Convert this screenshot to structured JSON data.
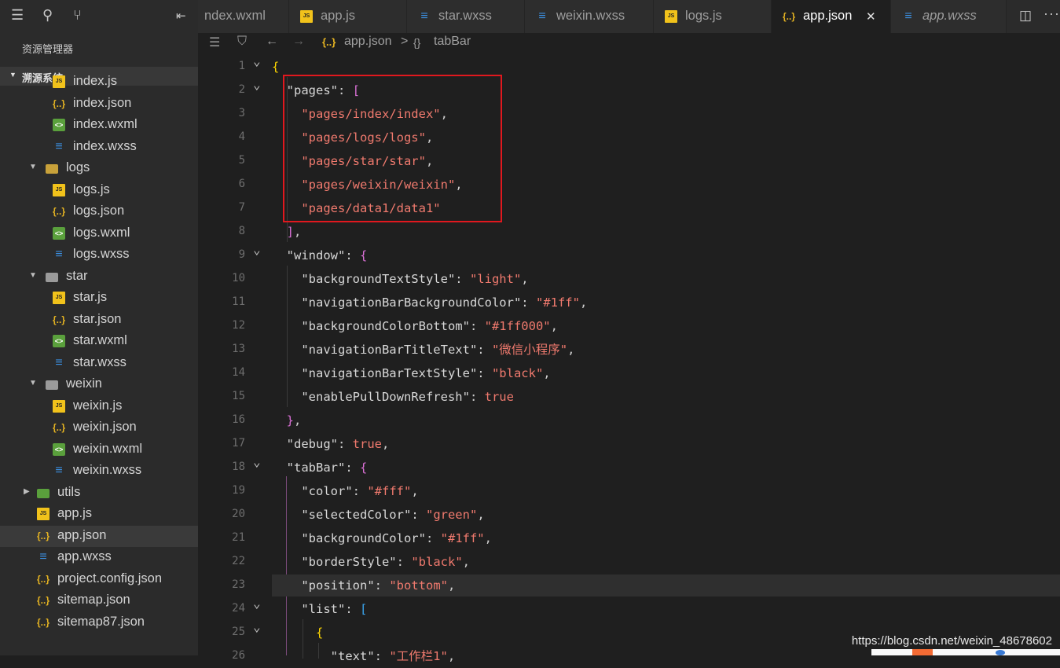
{
  "sidebar": {
    "title": "资源管理器",
    "section": "溯源系统",
    "items": [
      {
        "name": "index.js",
        "type": "js",
        "indent": 2,
        "twisty": ""
      },
      {
        "name": "index.json",
        "type": "json",
        "indent": 2,
        "twisty": ""
      },
      {
        "name": "index.wxml",
        "type": "wxml",
        "indent": 2,
        "twisty": ""
      },
      {
        "name": "index.wxss",
        "type": "wxss",
        "indent": 2,
        "twisty": ""
      },
      {
        "name": "logs",
        "type": "folder-open",
        "indent": 1,
        "twisty": "▼"
      },
      {
        "name": "logs.js",
        "type": "js",
        "indent": 2,
        "twisty": ""
      },
      {
        "name": "logs.json",
        "type": "json",
        "indent": 2,
        "twisty": ""
      },
      {
        "name": "logs.wxml",
        "type": "wxml",
        "indent": 2,
        "twisty": ""
      },
      {
        "name": "logs.wxss",
        "type": "wxss",
        "indent": 2,
        "twisty": ""
      },
      {
        "name": "star",
        "type": "folder",
        "indent": 1,
        "twisty": "▼"
      },
      {
        "name": "star.js",
        "type": "js",
        "indent": 2,
        "twisty": ""
      },
      {
        "name": "star.json",
        "type": "json",
        "indent": 2,
        "twisty": ""
      },
      {
        "name": "star.wxml",
        "type": "wxml",
        "indent": 2,
        "twisty": ""
      },
      {
        "name": "star.wxss",
        "type": "wxss",
        "indent": 2,
        "twisty": ""
      },
      {
        "name": "weixin",
        "type": "folder",
        "indent": 1,
        "twisty": "▼"
      },
      {
        "name": "weixin.js",
        "type": "js",
        "indent": 2,
        "twisty": ""
      },
      {
        "name": "weixin.json",
        "type": "json",
        "indent": 2,
        "twisty": ""
      },
      {
        "name": "weixin.wxml",
        "type": "wxml",
        "indent": 2,
        "twisty": ""
      },
      {
        "name": "weixin.wxss",
        "type": "wxss",
        "indent": 2,
        "twisty": ""
      },
      {
        "name": "utils",
        "type": "utils",
        "indent": 0,
        "twisty": "▶"
      },
      {
        "name": "app.js",
        "type": "js",
        "indent": 0,
        "twisty": ""
      },
      {
        "name": "app.json",
        "type": "json",
        "indent": 0,
        "twisty": "",
        "selected": true
      },
      {
        "name": "app.wxss",
        "type": "wxss",
        "indent": 0,
        "twisty": ""
      },
      {
        "name": "project.config.json",
        "type": "json",
        "indent": 0,
        "twisty": ""
      },
      {
        "name": "sitemap.json",
        "type": "json",
        "indent": 0,
        "twisty": ""
      },
      {
        "name": "sitemap87.json",
        "type": "json",
        "indent": 0,
        "twisty": ""
      }
    ]
  },
  "icons": {
    "js": "JS",
    "json": "{..}",
    "wxml": "<>",
    "wxss": "≡"
  },
  "tabs": [
    {
      "label": "ndex.wxml",
      "type": "",
      "active": false
    },
    {
      "label": "app.js",
      "type": "js",
      "active": false
    },
    {
      "label": "star.wxss",
      "type": "wxss",
      "active": false
    },
    {
      "label": "weixin.wxss",
      "type": "wxss",
      "active": false
    },
    {
      "label": "logs.js",
      "type": "js",
      "active": false
    },
    {
      "label": "app.json",
      "type": "json",
      "active": true
    },
    {
      "label": "app.wxss",
      "type": "wxss",
      "active": false,
      "italic": true
    }
  ],
  "breadcrumb": {
    "file": "app.json",
    "separator": ">",
    "symbol": "tabBar"
  },
  "code": [
    {
      "n": 1,
      "fold": true,
      "toks": [
        [
          "b1",
          "{"
        ]
      ]
    },
    {
      "n": 2,
      "fold": true,
      "toks": [
        [
          "sp",
          "  "
        ],
        [
          "key",
          "\"pages\""
        ],
        [
          "p",
          ": "
        ],
        [
          "b2",
          "["
        ]
      ]
    },
    {
      "n": 3,
      "toks": [
        [
          "sp",
          "    "
        ],
        [
          "str",
          "\"pages/index/index\""
        ],
        [
          "p",
          ","
        ]
      ]
    },
    {
      "n": 4,
      "toks": [
        [
          "sp",
          "    "
        ],
        [
          "str",
          "\"pages/logs/logs\""
        ],
        [
          "p",
          ","
        ]
      ]
    },
    {
      "n": 5,
      "toks": [
        [
          "sp",
          "    "
        ],
        [
          "str",
          "\"pages/star/star\""
        ],
        [
          "p",
          ","
        ]
      ]
    },
    {
      "n": 6,
      "toks": [
        [
          "sp",
          "    "
        ],
        [
          "str",
          "\"pages/weixin/weixin\""
        ],
        [
          "p",
          ","
        ]
      ]
    },
    {
      "n": 7,
      "toks": [
        [
          "sp",
          "    "
        ],
        [
          "str",
          "\"pages/data1/data1\""
        ]
      ]
    },
    {
      "n": 8,
      "toks": [
        [
          "sp",
          "  "
        ],
        [
          "b2",
          "]"
        ],
        [
          "p",
          ","
        ]
      ]
    },
    {
      "n": 9,
      "fold": true,
      "toks": [
        [
          "sp",
          "  "
        ],
        [
          "key",
          "\"window\""
        ],
        [
          "p",
          ": "
        ],
        [
          "b2",
          "{"
        ]
      ]
    },
    {
      "n": 10,
      "toks": [
        [
          "sp",
          "    "
        ],
        [
          "key",
          "\"backgroundTextStyle\""
        ],
        [
          "p",
          ": "
        ],
        [
          "str",
          "\"light\""
        ],
        [
          "p",
          ","
        ]
      ]
    },
    {
      "n": 11,
      "toks": [
        [
          "sp",
          "    "
        ],
        [
          "key",
          "\"navigationBarBackgroundColor\""
        ],
        [
          "p",
          ": "
        ],
        [
          "str",
          "\"#1ff\""
        ],
        [
          "p",
          ","
        ]
      ]
    },
    {
      "n": 12,
      "toks": [
        [
          "sp",
          "    "
        ],
        [
          "key",
          "\"backgroundColorBottom\""
        ],
        [
          "p",
          ": "
        ],
        [
          "str",
          "\"#1ff000\""
        ],
        [
          "p",
          ","
        ]
      ]
    },
    {
      "n": 13,
      "toks": [
        [
          "sp",
          "    "
        ],
        [
          "key",
          "\"navigationBarTitleText\""
        ],
        [
          "p",
          ": "
        ],
        [
          "str",
          "\"微信小程序\""
        ],
        [
          "p",
          ","
        ]
      ]
    },
    {
      "n": 14,
      "toks": [
        [
          "sp",
          "    "
        ],
        [
          "key",
          "\"navigationBarTextStyle\""
        ],
        [
          "p",
          ": "
        ],
        [
          "str",
          "\"black\""
        ],
        [
          "p",
          ","
        ]
      ]
    },
    {
      "n": 15,
      "toks": [
        [
          "sp",
          "    "
        ],
        [
          "key",
          "\"enablePullDownRefresh\""
        ],
        [
          "p",
          ": "
        ],
        [
          "bool",
          "true"
        ]
      ]
    },
    {
      "n": 16,
      "toks": [
        [
          "sp",
          "  "
        ],
        [
          "b2",
          "}"
        ],
        [
          "p",
          ","
        ]
      ]
    },
    {
      "n": 17,
      "toks": [
        [
          "sp",
          "  "
        ],
        [
          "key",
          "\"debug\""
        ],
        [
          "p",
          ": "
        ],
        [
          "bool",
          "true"
        ],
        [
          "p",
          ","
        ]
      ]
    },
    {
      "n": 18,
      "fold": true,
      "toks": [
        [
          "sp",
          "  "
        ],
        [
          "key",
          "\"tabBar\""
        ],
        [
          "p",
          ": "
        ],
        [
          "b2",
          "{"
        ]
      ]
    },
    {
      "n": 19,
      "toks": [
        [
          "sp",
          "    "
        ],
        [
          "key",
          "\"color\""
        ],
        [
          "p",
          ": "
        ],
        [
          "str",
          "\"#fff\""
        ],
        [
          "p",
          ","
        ]
      ]
    },
    {
      "n": 20,
      "toks": [
        [
          "sp",
          "    "
        ],
        [
          "key",
          "\"selectedColor\""
        ],
        [
          "p",
          ": "
        ],
        [
          "str",
          "\"green\""
        ],
        [
          "p",
          ","
        ]
      ]
    },
    {
      "n": 21,
      "toks": [
        [
          "sp",
          "    "
        ],
        [
          "key",
          "\"backgroundColor\""
        ],
        [
          "p",
          ": "
        ],
        [
          "str",
          "\"#1ff\""
        ],
        [
          "p",
          ","
        ]
      ]
    },
    {
      "n": 22,
      "toks": [
        [
          "sp",
          "    "
        ],
        [
          "key",
          "\"borderStyle\""
        ],
        [
          "p",
          ": "
        ],
        [
          "str",
          "\"black\""
        ],
        [
          "p",
          ","
        ]
      ]
    },
    {
      "n": 23,
      "highlight": true,
      "toks": [
        [
          "sp",
          "    "
        ],
        [
          "key",
          "\"position\""
        ],
        [
          "p",
          ": "
        ],
        [
          "str",
          "\"bottom\""
        ],
        [
          "p",
          ","
        ]
      ]
    },
    {
      "n": 24,
      "fold": true,
      "toks": [
        [
          "sp",
          "    "
        ],
        [
          "key",
          "\"list\""
        ],
        [
          "p",
          ": "
        ],
        [
          "b3",
          "["
        ]
      ]
    },
    {
      "n": 25,
      "fold": true,
      "toks": [
        [
          "sp",
          "      "
        ],
        [
          "b1",
          "{"
        ]
      ]
    },
    {
      "n": 26,
      "toks": [
        [
          "sp",
          "        "
        ],
        [
          "key",
          "\"text\""
        ],
        [
          "p",
          ": "
        ],
        [
          "str",
          "\"工作栏1\""
        ],
        [
          "p",
          ","
        ]
      ]
    }
  ],
  "watermark": "https://blog.csdn.net/weixin_48678602"
}
